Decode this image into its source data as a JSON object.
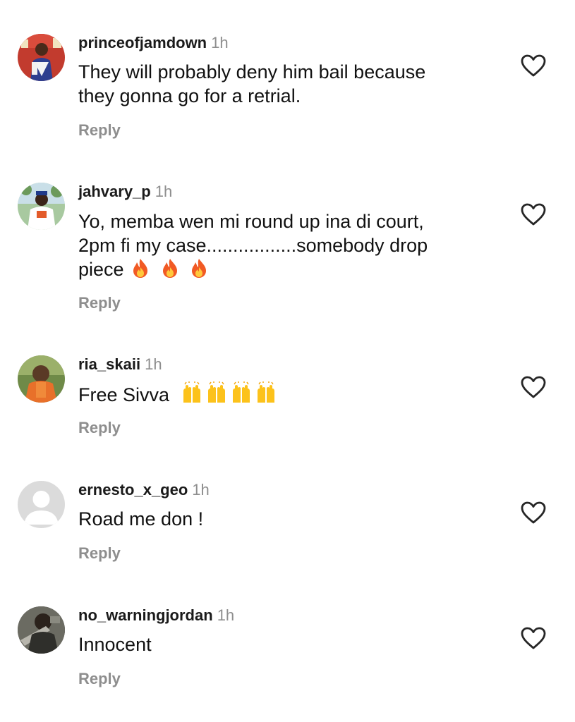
{
  "comments": [
    {
      "username": "princeofjamdown",
      "time": "1h",
      "text_lines": [
        "They will probably deny him bail because",
        "they gonna go for a retrial."
      ],
      "reply_label": "Reply"
    },
    {
      "username": "jahvary_p",
      "time": "1h",
      "text_lines": [
        "Yo, memba wen mi round up ina di court,",
        "2pm fi my case.................somebody drop",
        "piece"
      ],
      "emoji": [
        "fire-emoji",
        "fire-emoji",
        "fire-emoji"
      ],
      "reply_label": "Reply"
    },
    {
      "username": "ria_skaii",
      "time": "1h",
      "text_lines": [
        "Free Sivva"
      ],
      "emoji": [
        "raising-hands-emoji",
        "raising-hands-emoji",
        "raising-hands-emoji",
        "raising-hands-emoji"
      ],
      "reply_label": "Reply"
    },
    {
      "username": "ernesto_x_geo",
      "time": "1h",
      "text_lines": [
        "Road me don !"
      ],
      "reply_label": "Reply"
    },
    {
      "username": "no_warningjordan",
      "time": "1h",
      "text_lines": [
        "Innocent"
      ],
      "reply_label": "Reply"
    }
  ],
  "icons": {
    "like": "heart-outline-icon"
  },
  "colors": {
    "username": "#1a1a1a",
    "meta": "#8e8e8e",
    "text": "#111111",
    "background": "#ffffff"
  }
}
